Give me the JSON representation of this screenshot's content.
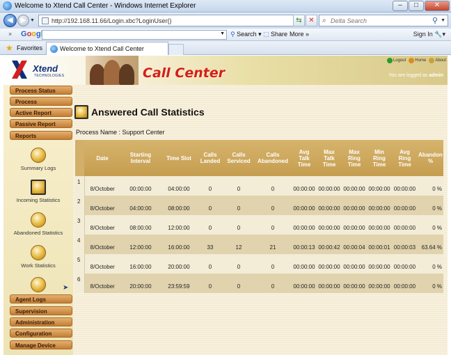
{
  "window": {
    "title": "Welcome to Xtend Call Center - Windows Internet Explorer",
    "minimize": "–",
    "maximize": "□",
    "close": "✕"
  },
  "address": {
    "back": "◀",
    "forward": "▶",
    "url": "http://192.168.11.66/Login.xbc?LoginUser()",
    "search_placeholder": "Delta Search"
  },
  "google_bar": {
    "close": "×",
    "logo": [
      "G",
      "o",
      "o",
      "g",
      "l",
      "e"
    ],
    "search_label": "Search",
    "share_label": "Share",
    "more_label": "More »",
    "signin_label": "Sign In"
  },
  "favorites": {
    "label": "Favorites",
    "tab_title": "Welcome to Xtend Call Center"
  },
  "header": {
    "logo_text": "Xtend",
    "logo_sub": "TECHNOLOGIES",
    "app_title": "Call Center",
    "links": [
      "Logout",
      "Home",
      "About"
    ],
    "logged_prefix": "You are logged as",
    "user": "admin"
  },
  "sidebar": {
    "top_menu": [
      "Process Status",
      "Process",
      "Active Report",
      "Passive Report",
      "Reports"
    ],
    "report_items": [
      "Summary Logs",
      "Incoming Statistics",
      "Abandoned Statistics",
      "Work Statistics"
    ],
    "bottom_menu": [
      "Agent Logs",
      "Supervision",
      "Administration",
      "Configuration",
      "Manage Device"
    ]
  },
  "main": {
    "title": "Answered Call Statistics",
    "process_name": "Process Name : Support Center",
    "columns": [
      [
        "",
        ""
      ],
      [
        "Date"
      ],
      [
        "Starting",
        "Interval"
      ],
      [
        "Time Slot"
      ],
      [
        "Calls",
        "Landed"
      ],
      [
        "Calls",
        "Serviced"
      ],
      [
        "Calls",
        "Abandoned"
      ],
      [
        "Avg",
        "Talk",
        "Time"
      ],
      [
        "Max",
        "Talk",
        "Time"
      ],
      [
        "Max",
        "Ring",
        "Time"
      ],
      [
        "Min",
        "Ring",
        "Time"
      ],
      [
        "Avg",
        "Ring",
        "Time"
      ],
      [
        "Abandon",
        "%"
      ]
    ],
    "rows": [
      [
        "1",
        "8/October",
        "00:00:00",
        "04:00:00",
        "0",
        "0",
        "0",
        "00:00:00",
        "00:00:00",
        "00:00:00",
        "00:00:00",
        "00:00:00",
        "0 %"
      ],
      [
        "2",
        "8/October",
        "04:00:00",
        "08:00:00",
        "0",
        "0",
        "0",
        "00:00:00",
        "00:00:00",
        "00:00:00",
        "00:00:00",
        "00:00:00",
        "0 %"
      ],
      [
        "3",
        "8/October",
        "08:00:00",
        "12:00:00",
        "0",
        "0",
        "0",
        "00:00:00",
        "00:00:00",
        "00:00:00",
        "00:00:00",
        "00:00:00",
        "0 %"
      ],
      [
        "4",
        "8/October",
        "12:00:00",
        "16:00:00",
        "33",
        "12",
        "21",
        "00:00:13",
        "00:00:42",
        "00:00:04",
        "00:00:01",
        "00:00:03",
        "63.64 %"
      ],
      [
        "5",
        "8/October",
        "16:00:00",
        "20:00:00",
        "0",
        "0",
        "0",
        "00:00:00",
        "00:00:00",
        "00:00:00",
        "00:00:00",
        "00:00:00",
        "0 %"
      ],
      [
        "6",
        "8/October",
        "20:00:00",
        "23:59:59",
        "0",
        "0",
        "0",
        "00:00:00",
        "00:00:00",
        "00:00:00",
        "00:00:00",
        "00:00:00",
        "0 %"
      ]
    ]
  },
  "colors": {
    "menu_button": "#c47e35",
    "table_header": "#c9a355",
    "call_center_red": "#d21f1f"
  }
}
